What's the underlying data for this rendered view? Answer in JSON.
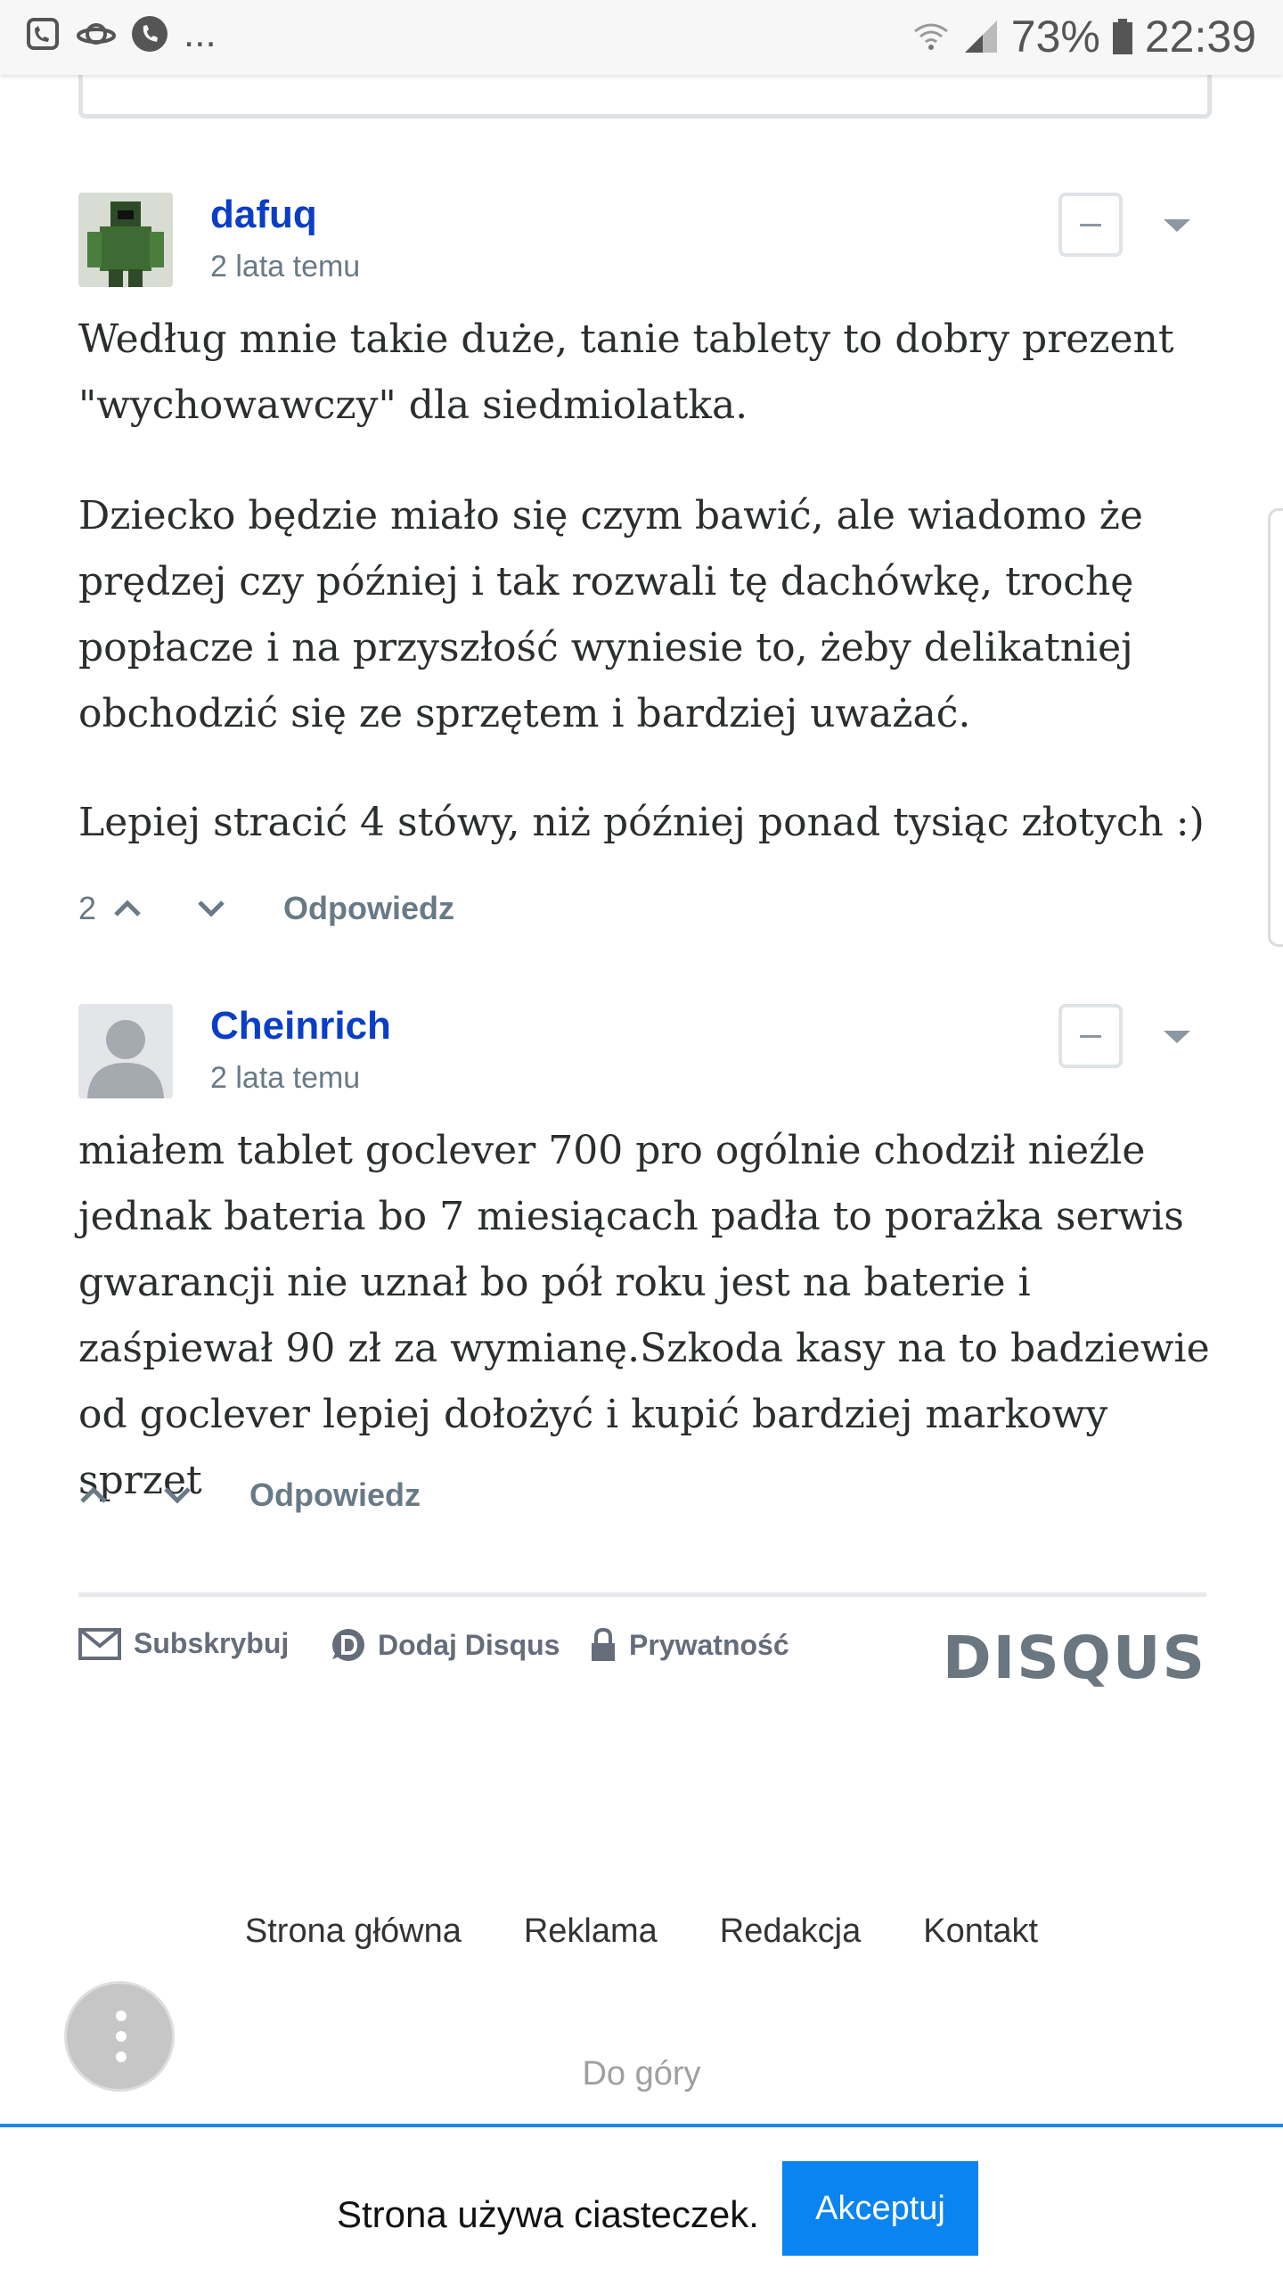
{
  "status_bar": {
    "battery": "73%",
    "time": "22:39",
    "more": "..."
  },
  "comments": [
    {
      "author": "dafuq",
      "time": "2 lata temu",
      "paragraphs": [
        "Według mnie takie duże, tanie tablety to dobry prezent \"wychowawczy\" dla siedmiolatka.",
        "Dziecko będzie miało się czym bawić, ale wiadomo że prędzej czy później i tak rozwali tę dachówkę, trochę popłacze i na przyszłość wyniesie to, żeby delikatniej obchodzić się ze sprzętem i bardziej uważać.",
        "Lepiej stracić 4 stówy, niż później ponad tysiąc złotych :)"
      ],
      "votes": "2",
      "reply": "Odpowiedz"
    },
    {
      "author": "Cheinrich",
      "time": "2 lata temu",
      "paragraphs": [
        "miałem tablet goclever 700 pro ogólnie chodził nieźle jednak bateria bo 7 miesiącach padła to porażka serwis gwarancji nie uznał bo pół roku jest na baterie i zaśpiewał 90 zł za wymianę.Szkoda kasy na to badziewie od goclever lepiej dołożyć i kupić bardziej markowy sprzet"
      ],
      "votes": "",
      "reply": "Odpowiedz"
    }
  ],
  "disqus_footer": {
    "subscribe": "Subskrybuj",
    "add_disqus": "Dodaj Disqus",
    "privacy": "Prywatność",
    "logo": "DISQUS"
  },
  "site_footer": {
    "links": [
      "Strona główna",
      "Reklama",
      "Redakcja",
      "Kontakt"
    ],
    "to_top": "Do góry"
  },
  "cookie": {
    "text": "Strona używa ciasteczek.",
    "accept": "Akceptuj"
  },
  "colors": {
    "author": "#0a3ec6",
    "accept_button": "#0a84f0",
    "cookie_border": "#1e88e5"
  }
}
